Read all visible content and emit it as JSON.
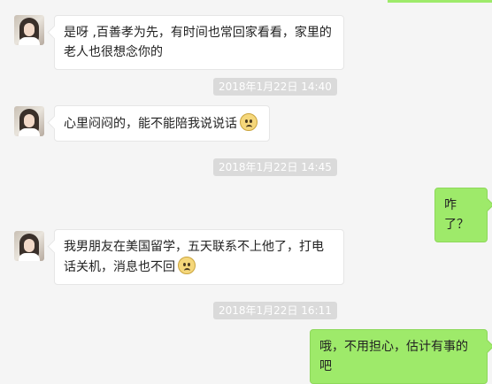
{
  "messages": [
    {
      "side": "in",
      "text": "是呀 ,百善孝为先，有时间也常回家看看，家里的老人也很想念你的",
      "emoji": ""
    },
    {
      "side": "in",
      "text": "心里闷闷的，能不能陪我说说话",
      "emoji": "sad-face-icon"
    },
    {
      "side": "out",
      "text": "咋了？",
      "emoji": ""
    },
    {
      "side": "in",
      "text": "我男朋友在美国留学，五天联系不上他了，打电话关机，消息也不回",
      "emoji": "sad-face-icon"
    },
    {
      "side": "out",
      "text": "哦，不用担心，估计有事的吧",
      "emoji": ""
    }
  ],
  "timestamps": [
    "2018年1月22日 14:40",
    "2018年1月22日 14:45",
    "2018年1月22日 16:11"
  ],
  "colors": {
    "background": "#f5f5f5",
    "incoming_bubble": "#ffffff",
    "outgoing_bubble": "#9eea6a",
    "timestamp_badge": "#dadada"
  }
}
